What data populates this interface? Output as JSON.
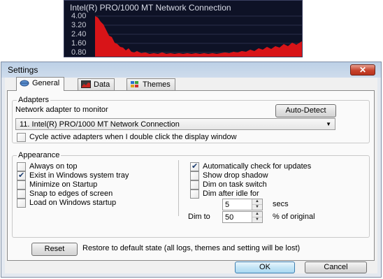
{
  "monitor": {
    "title": "Intel(R) PRO/1000 MT Network Connection",
    "y_labels": [
      "4.00",
      "3.20",
      "2.40",
      "1.60",
      "0.80"
    ],
    "colors": {
      "background": "#0e1226",
      "fill": "#d81418",
      "text": "#c9ccd6"
    }
  },
  "window": {
    "title": "Settings",
    "close_symbol": "✕",
    "tabs": [
      {
        "label": "General",
        "icon": "network-icon"
      },
      {
        "label": "Data",
        "icon": "chart-icon"
      },
      {
        "label": "Themes",
        "icon": "palette-icon"
      }
    ],
    "adapters": {
      "group_title": "Adapters",
      "monitor_label": "Network adapter to monitor",
      "auto_detect": "Auto-Detect",
      "selected_adapter": "11. Intel(R) PRO/1000 MT Network Connection",
      "cycle_label": "Cycle active adapters when I double click the display window",
      "cycle_checked": false
    },
    "appearance": {
      "group_title": "Appearance",
      "left_options": [
        {
          "label": "Always on top",
          "checked": false
        },
        {
          "label": "Exist in Windows system tray",
          "checked": true
        },
        {
          "label": "Minimize on Startup",
          "checked": false
        },
        {
          "label": "Snap to edges of screen",
          "checked": false
        },
        {
          "label": "Load on Windows startup",
          "checked": false
        }
      ],
      "right_options": [
        {
          "label": "Automatically check for updates",
          "checked": true
        },
        {
          "label": "Show drop shadow",
          "checked": false
        },
        {
          "label": "Dim on task switch",
          "checked": false
        },
        {
          "label": "Dim after idle for",
          "checked": false
        }
      ],
      "idle_value": "5",
      "idle_unit": "secs",
      "dim_to_label": "Dim to",
      "dim_to_value": "50",
      "dim_to_unit": "% of original"
    },
    "reset": {
      "button": "Reset",
      "description": "Restore to default state (all logs, themes and setting will be lost)"
    },
    "ok_button": "OK",
    "cancel_button": "Cancel"
  }
}
